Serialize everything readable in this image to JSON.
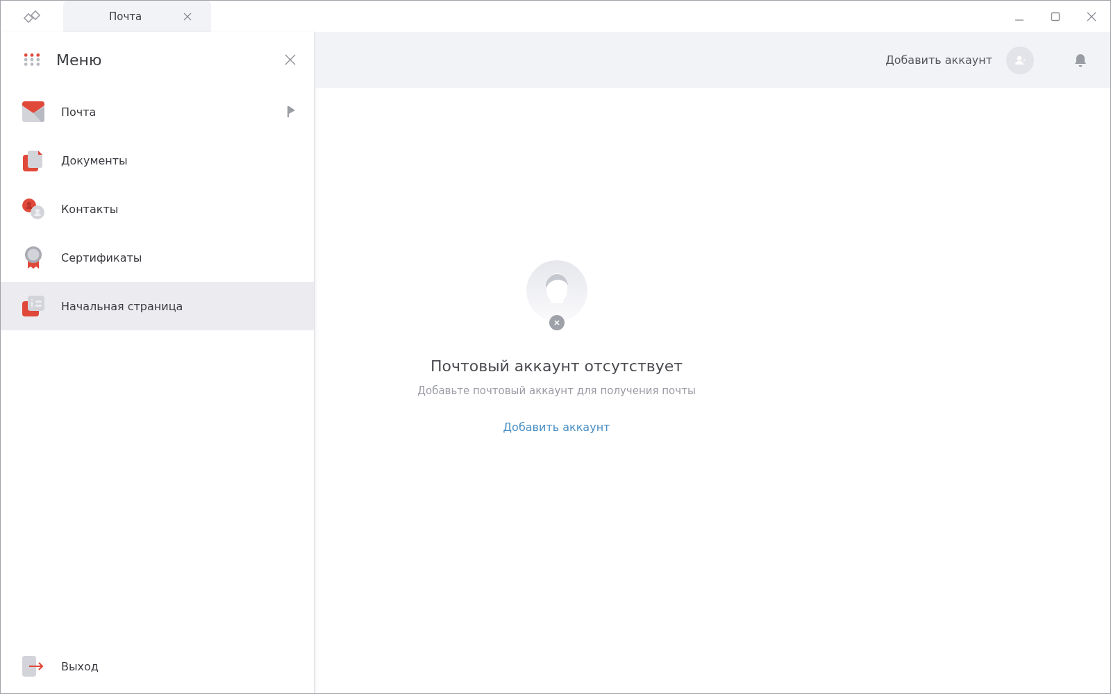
{
  "tabs": [
    {
      "label": "Почта",
      "selected": true
    }
  ],
  "menu": {
    "title": "Меню",
    "items": [
      {
        "kind": "mail",
        "label": "Почта",
        "selected": false,
        "flagged": true
      },
      {
        "kind": "documents",
        "label": "Документы",
        "selected": false,
        "flagged": false
      },
      {
        "kind": "contacts",
        "label": "Контакты",
        "selected": false,
        "flagged": false
      },
      {
        "kind": "certificates",
        "label": "Сертификаты",
        "selected": false,
        "flagged": false
      },
      {
        "kind": "home",
        "label": "Начальная страница",
        "selected": true,
        "flagged": false
      }
    ],
    "exit": "Выход"
  },
  "header": {
    "add_account": "Добавить аккаунт"
  },
  "empty_state": {
    "title": "Почтовый аккаунт отсутствует",
    "subtitle": "Добавьте почтовый аккаунт для получения почты",
    "link": "Добавить аккаунт"
  }
}
